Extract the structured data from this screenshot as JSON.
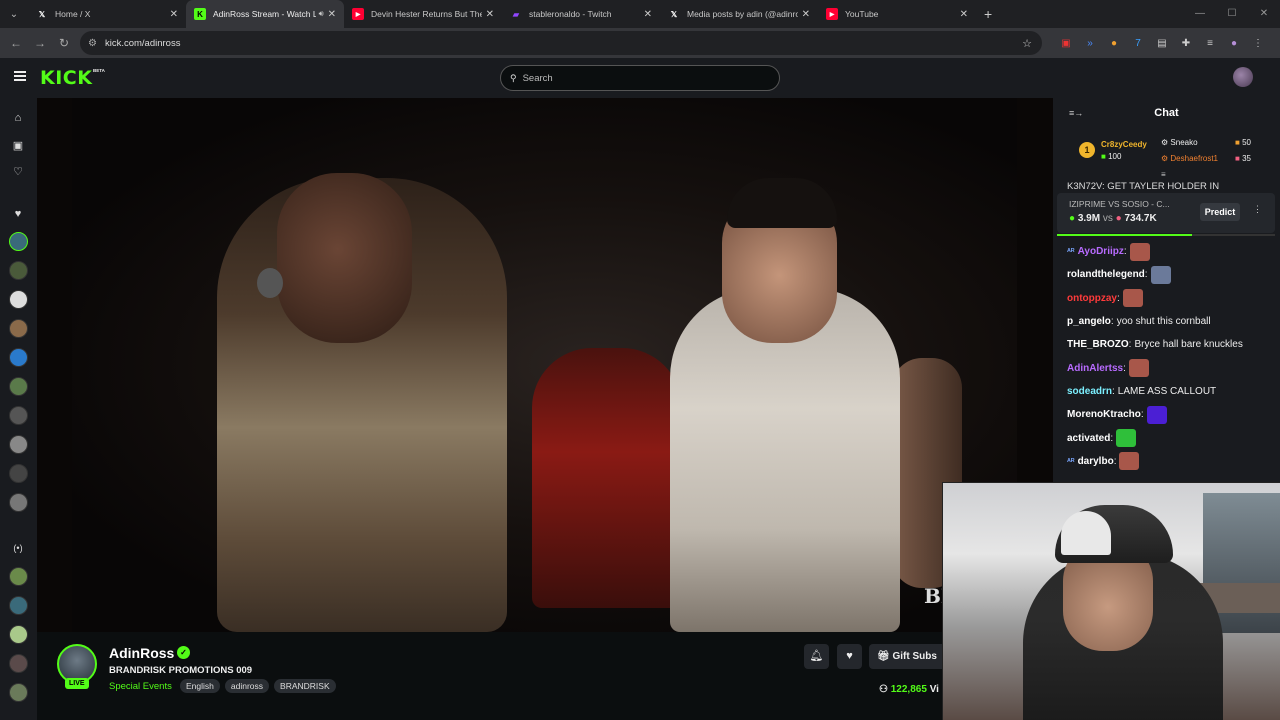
{
  "browser": {
    "tabs": [
      {
        "title": "Home / X",
        "favicon": "x-icon",
        "fav_color": "#ffffff"
      },
      {
        "title": "AdinRoss Stream - Watch Live",
        "favicon": "kick-icon",
        "fav_color": "#53fc18",
        "active": true
      },
      {
        "title": "Devin Hester Returns But They",
        "favicon": "youtube-icon",
        "fav_color": "#ff0033"
      },
      {
        "title": "stableronaldo - Twitch",
        "favicon": "twitch-icon",
        "fav_color": "#9146ff"
      },
      {
        "title": "Media posts by adin (@adinross)",
        "favicon": "x-icon",
        "fav_color": "#ffffff"
      },
      {
        "title": "YouTube",
        "favicon": "youtube-icon",
        "fav_color": "#ff0033"
      }
    ],
    "url": "kick.com/adinross"
  },
  "kick": {
    "logo": "KICK",
    "logo_badge": "BETA",
    "search_placeholder": "Search",
    "accent": "#53fc18"
  },
  "channel": {
    "name": "AdinRoss",
    "live_label": "LIVE",
    "stream_title": "BRANDRISK PROMOTIONS 009",
    "category": "Special Events",
    "tags": [
      "English",
      "adinross",
      "BRANDRISK"
    ],
    "gift_label": "Gift Subs",
    "viewers": "122,865",
    "viewers_suffix": "Vi",
    "video_watermark": "BR"
  },
  "chat": {
    "title": "Chat",
    "leaderboard": {
      "rank": "1",
      "top_user": "Cr8zyCeedy",
      "top_value": "100",
      "others": [
        {
          "user": "Sneako",
          "value": "50"
        },
        {
          "user": "Deshaefrost1",
          "value": "35"
        }
      ]
    },
    "pinned_peek": "K3N72V: GET TAYLER HOLDER IN",
    "prediction": {
      "title": "IZIPRIME VS SOSIO - C...",
      "left_value": "3.9M",
      "vs": "vs",
      "right_value": "734.7K",
      "button": "Predict",
      "progress": 0.62
    },
    "messages": [
      {
        "user": "AyoDriipz",
        "color": "#b86bff",
        "text": "",
        "emote": "#a8574a",
        "badge": true
      },
      {
        "user": "rolandthelegend",
        "color": "#ffffff",
        "text": "",
        "emote": "#6b7a9a"
      },
      {
        "user": "ontoppzay",
        "color": "#ff3b3b",
        "text": "",
        "emote": "#a8574a"
      },
      {
        "user": "p_angelo",
        "color": "#ffffff",
        "text": "yoo shut this cornball"
      },
      {
        "user": "THE_BROZO",
        "color": "#ffffff",
        "text": "Bryce hall bare knuckles"
      },
      {
        "user": "AdinAlertss",
        "color": "#b86bff",
        "text": "",
        "emote": "#a8574a"
      },
      {
        "user": "sodeadrn",
        "color": "#7cf0ff",
        "text": "LAME ASS CALLOUT"
      },
      {
        "user": "MorenoKtracho",
        "color": "#ffffff",
        "text": "",
        "emote": "#4b1fd4"
      },
      {
        "user": "activated",
        "color": "#ffffff",
        "text": "",
        "emote": "#2fbf3a"
      },
      {
        "user": "darylbo",
        "color": "#ffffff",
        "text": "",
        "emote": "#a8574a",
        "badge": true
      }
    ]
  }
}
